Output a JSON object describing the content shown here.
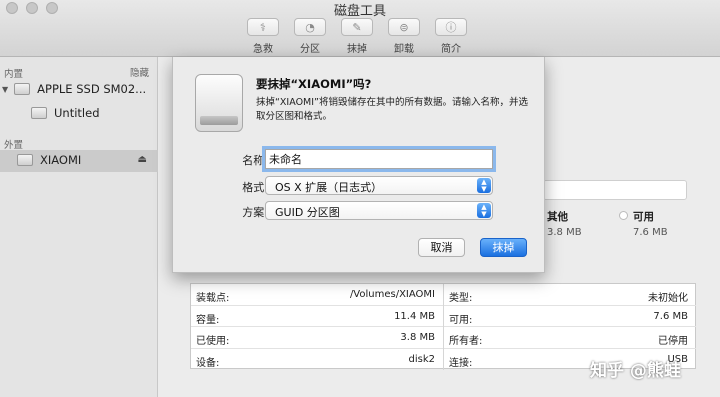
{
  "window": {
    "title": "磁盘工具"
  },
  "toolbar": {
    "items": [
      {
        "label": "急救",
        "icon": "first-aid-icon"
      },
      {
        "label": "分区",
        "icon": "partition-icon"
      },
      {
        "label": "抹掉",
        "icon": "erase-icon"
      },
      {
        "label": "卸载",
        "icon": "unmount-icon"
      },
      {
        "label": "简介",
        "icon": "info-icon"
      }
    ]
  },
  "sidebar": {
    "internal_header": "内置",
    "hide_label": "隐藏",
    "internal_disk": "APPLE SSD SM02...",
    "internal_volume": "Untitled",
    "external_header": "外置",
    "external_disk": "XIAOMI",
    "eject_glyph": "⏏"
  },
  "sheet": {
    "title": "要抹掉“XIAOMI”吗?",
    "message": "抹掉“XIAOMI”将销毁储存在其中的所有数据。请输入名称，并选取分区图和格式。",
    "name_label": "名称:",
    "name_value": "未命名",
    "format_label": "格式:",
    "format_value": "OS X 扩展（日志式）",
    "scheme_label": "方案:",
    "scheme_value": "GUID 分区图",
    "cancel_label": "取消",
    "erase_label": "抹掉"
  },
  "usage_legend": {
    "other_label": "其他",
    "other_value": "3.8 MB",
    "free_label": "可用",
    "free_value": "7.6 MB"
  },
  "info_table": {
    "left": [
      {
        "key": "装载点:",
        "value": "/Volumes/XIAOMI"
      },
      {
        "key": "容量:",
        "value": "11.4 MB"
      },
      {
        "key": "已使用:",
        "value": "3.8 MB"
      },
      {
        "key": "设备:",
        "value": "disk2"
      }
    ],
    "right": [
      {
        "key": "类型:",
        "value": "未初始化"
      },
      {
        "key": "可用:",
        "value": "7.6 MB"
      },
      {
        "key": "所有者:",
        "value": "已停用"
      },
      {
        "key": "连接:",
        "value": "USB"
      }
    ]
  },
  "watermark": "知乎 @熊蛙",
  "colors": {
    "accent": "#1b70e0",
    "focus_ring": "#8bb8ec",
    "selection": "#cbcbcb"
  }
}
